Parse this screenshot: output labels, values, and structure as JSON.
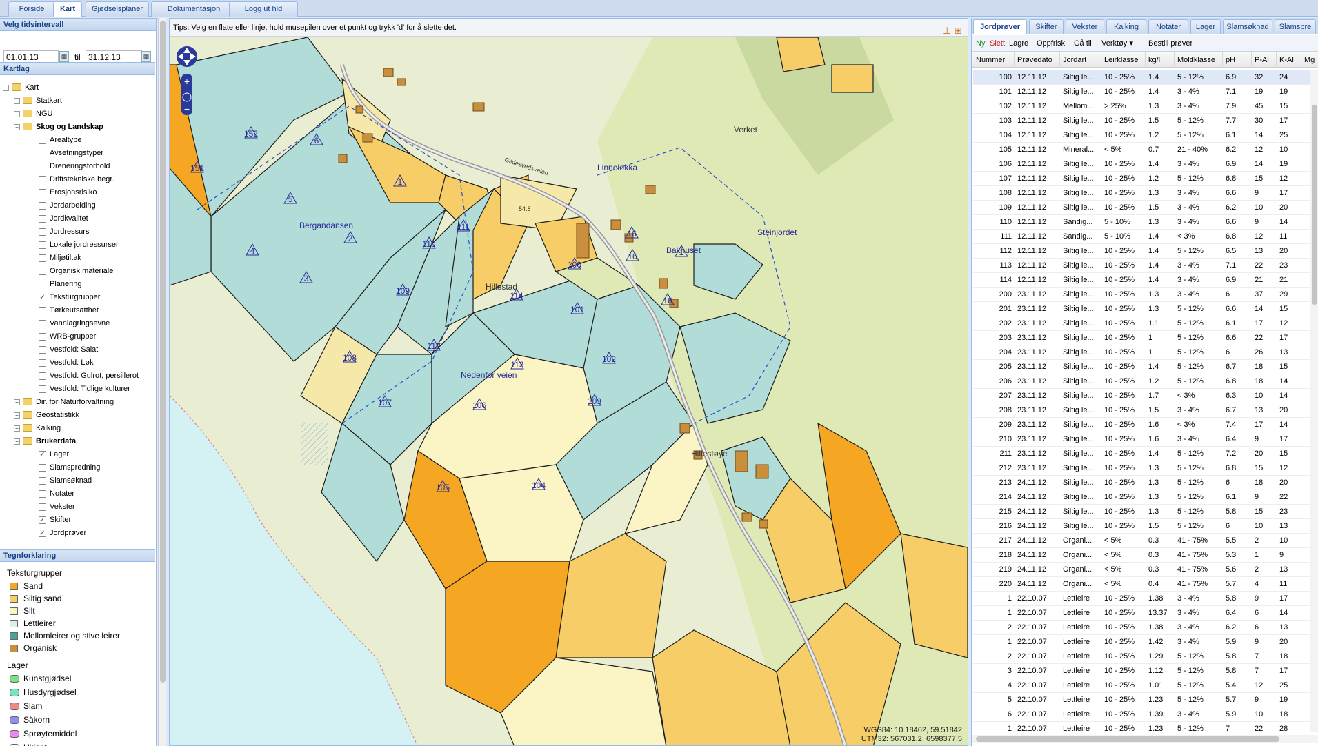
{
  "top_tabs": [
    {
      "label": "Forside",
      "active": false
    },
    {
      "label": "Kart",
      "active": true
    },
    {
      "label": "Gjødselsplaner",
      "active": false
    },
    {
      "label": "Dokumentasjon",
      "active": false
    },
    {
      "label": "Logg ut hld",
      "active": false
    }
  ],
  "time_interval": {
    "title": "Velg tidsintervall",
    "from": "01.01.13",
    "to_label": "til",
    "to": "31.12.13"
  },
  "layers": {
    "title": "Kartlag",
    "tree": [
      {
        "label": "Kart",
        "level": 0,
        "type": "folder",
        "expanded": true
      },
      {
        "label": "Statkart",
        "level": 1,
        "type": "folder",
        "expanded": false
      },
      {
        "label": "NGU",
        "level": 1,
        "type": "folder",
        "expanded": false
      },
      {
        "label": "Skog og Landskap",
        "level": 1,
        "type": "folder",
        "expanded": true,
        "bold": true
      },
      {
        "label": "Arealtype",
        "level": 2,
        "type": "check",
        "checked": false
      },
      {
        "label": "Avsetningstyper",
        "level": 2,
        "type": "check",
        "checked": false
      },
      {
        "label": "Dreneringsforhold",
        "level": 2,
        "type": "check",
        "checked": false
      },
      {
        "label": "Driftstekniske begr.",
        "level": 2,
        "type": "check",
        "checked": false
      },
      {
        "label": "Erosjonsrisiko",
        "level": 2,
        "type": "check",
        "checked": false
      },
      {
        "label": "Jordarbeiding",
        "level": 2,
        "type": "check",
        "checked": false
      },
      {
        "label": "Jordkvalitet",
        "level": 2,
        "type": "check",
        "checked": false
      },
      {
        "label": "Jordressurs",
        "level": 2,
        "type": "check",
        "checked": false
      },
      {
        "label": "Lokale jordressurser",
        "level": 2,
        "type": "check",
        "checked": false
      },
      {
        "label": "Miljøtiltak",
        "level": 2,
        "type": "check",
        "checked": false
      },
      {
        "label": "Organisk materiale",
        "level": 2,
        "type": "check",
        "checked": false
      },
      {
        "label": "Planering",
        "level": 2,
        "type": "check",
        "checked": false
      },
      {
        "label": "Teksturgrupper",
        "level": 2,
        "type": "check",
        "checked": true
      },
      {
        "label": "Tørkeutsatthet",
        "level": 2,
        "type": "check",
        "checked": false
      },
      {
        "label": "Vannlagringsevne",
        "level": 2,
        "type": "check",
        "checked": false
      },
      {
        "label": "WRB-grupper",
        "level": 2,
        "type": "check",
        "checked": false
      },
      {
        "label": "Vestfold: Salat",
        "level": 2,
        "type": "check",
        "checked": false
      },
      {
        "label": "Vestfold: Løk",
        "level": 2,
        "type": "check",
        "checked": false
      },
      {
        "label": "Vestfold: Gulrot, persillerot",
        "level": 2,
        "type": "check",
        "checked": false
      },
      {
        "label": "Vestfold: Tidlige kulturer",
        "level": 2,
        "type": "check",
        "checked": false
      },
      {
        "label": "Dir. for Naturforvaltning",
        "level": 1,
        "type": "folder",
        "expanded": false
      },
      {
        "label": "Geostatistikk",
        "level": 1,
        "type": "folder",
        "expanded": false
      },
      {
        "label": "Kalking",
        "level": 1,
        "type": "folder",
        "expanded": false
      },
      {
        "label": "Brukerdata",
        "level": 1,
        "type": "folder",
        "expanded": true,
        "bold": true
      },
      {
        "label": "Lager",
        "level": 2,
        "type": "check",
        "checked": true
      },
      {
        "label": "Slamspredning",
        "level": 2,
        "type": "check",
        "checked": false
      },
      {
        "label": "Slamsøknad",
        "level": 2,
        "type": "check",
        "checked": false
      },
      {
        "label": "Notater",
        "level": 2,
        "type": "check",
        "checked": false
      },
      {
        "label": "Vekster",
        "level": 2,
        "type": "check",
        "checked": false
      },
      {
        "label": "Skifter",
        "level": 2,
        "type": "check",
        "checked": true
      },
      {
        "label": "Jordprøver",
        "level": 2,
        "type": "check",
        "checked": true
      }
    ]
  },
  "legend": {
    "title": "Tegnforklaring",
    "groups": [
      {
        "title": "Teksturgrupper",
        "shape": "square",
        "items": [
          {
            "label": "Sand",
            "color": "#f5a623"
          },
          {
            "label": "Siltig sand",
            "color": "#f6cd67"
          },
          {
            "label": "Silt",
            "color": "#fbf5c6"
          },
          {
            "label": "Lettleirer",
            "color": "#d9efe8"
          },
          {
            "label": "Mellomleirer og stive leirer",
            "color": "#4aa3a0"
          },
          {
            "label": "Organisk",
            "color": "#c98f3c"
          }
        ]
      },
      {
        "title": "Lager",
        "shape": "round",
        "items": [
          {
            "label": "Kunstgjødsel",
            "color": "#7ee07e"
          },
          {
            "label": "Husdyrgjødsel",
            "color": "#7de2c3"
          },
          {
            "label": "Slam",
            "color": "#f08a86"
          },
          {
            "label": "Såkorn",
            "color": "#8f8ff2"
          },
          {
            "label": "Sprøytemiddel",
            "color": "#ef86ef"
          },
          {
            "label": "Ukjent",
            "color": "#ffffff"
          }
        ]
      }
    ]
  },
  "map": {
    "tips": "Tips: Velg en flate eller linje, hold musepilen over et punkt og trykk 'd' for å slette det.",
    "coords_wgs": "WGS84: 10.18462, 59.51842",
    "coords_utm": "UTM32: 567031.2, 6598377.5",
    "place_names": [
      "Verket",
      "Linneløkka",
      "Bergandansen",
      "Steinjordet",
      "Bakhuset",
      "Hillestad",
      "Nedenfor veien",
      "Hillestøye",
      "Gildesvedsveien",
      "54.8"
    ],
    "plots": [
      "152",
      "151",
      "6",
      "5",
      "1",
      "4",
      "2",
      "3",
      "111",
      "110",
      "109",
      "114",
      "101",
      "100",
      "108",
      "112",
      "113",
      "102",
      "107",
      "106",
      "103",
      "105",
      "104",
      "1",
      "16",
      "16",
      "16"
    ]
  },
  "grid": {
    "tabs": [
      "Jordprøver",
      "Skifter",
      "Vekster",
      "Kalking",
      "Notater",
      "Lager",
      "Slamsøknad",
      "Slamspre"
    ],
    "toolbar": {
      "new": "Ny",
      "delete": "Slett",
      "save": "Lagre",
      "refresh": "Oppfrisk",
      "goto": "Gå til",
      "tools": "Verktøy ▾",
      "order": "Bestill prøver"
    },
    "columns": [
      "Nummer",
      "Prøvedato",
      "Jordart",
      "Leirklasse",
      "kg/l",
      "Moldklasse",
      "pH",
      "P-Al",
      "K-Al",
      "Mg"
    ],
    "rows": [
      [
        "100",
        "12.11.12",
        "Siltig le...",
        "10 - 25%",
        "1.4",
        "5 - 12%",
        "6.9",
        "32",
        "24"
      ],
      [
        "101",
        "12.11.12",
        "Siltig le...",
        "10 - 25%",
        "1.4",
        "3 - 4%",
        "7.1",
        "19",
        "19"
      ],
      [
        "102",
        "12.11.12",
        "Mellom...",
        "> 25%",
        "1.3",
        "3 - 4%",
        "7.9",
        "45",
        "15"
      ],
      [
        "103",
        "12.11.12",
        "Siltig le...",
        "10 - 25%",
        "1.5",
        "5 - 12%",
        "7.7",
        "30",
        "17"
      ],
      [
        "104",
        "12.11.12",
        "Siltig le...",
        "10 - 25%",
        "1.2",
        "5 - 12%",
        "6.1",
        "14",
        "25"
      ],
      [
        "105",
        "12.11.12",
        "Mineral...",
        "< 5%",
        "0.7",
        "21 - 40%",
        "6.2",
        "12",
        "10"
      ],
      [
        "106",
        "12.11.12",
        "Siltig le...",
        "10 - 25%",
        "1.4",
        "3 - 4%",
        "6.9",
        "14",
        "19"
      ],
      [
        "107",
        "12.11.12",
        "Siltig le...",
        "10 - 25%",
        "1.2",
        "5 - 12%",
        "6.8",
        "15",
        "12"
      ],
      [
        "108",
        "12.11.12",
        "Siltig le...",
        "10 - 25%",
        "1.3",
        "3 - 4%",
        "6.6",
        "9",
        "17"
      ],
      [
        "109",
        "12.11.12",
        "Siltig le...",
        "10 - 25%",
        "1.5",
        "3 - 4%",
        "6.2",
        "10",
        "20"
      ],
      [
        "110",
        "12.11.12",
        "Sandig...",
        "5 - 10%",
        "1.3",
        "3 - 4%",
        "6.6",
        "9",
        "14"
      ],
      [
        "111",
        "12.11.12",
        "Sandig...",
        "5 - 10%",
        "1.4",
        "< 3%",
        "6.8",
        "12",
        "11"
      ],
      [
        "112",
        "12.11.12",
        "Siltig le...",
        "10 - 25%",
        "1.4",
        "5 - 12%",
        "6.5",
        "13",
        "20"
      ],
      [
        "113",
        "12.11.12",
        "Siltig le...",
        "10 - 25%",
        "1.4",
        "3 - 4%",
        "7.1",
        "22",
        "23"
      ],
      [
        "114",
        "12.11.12",
        "Siltig le...",
        "10 - 25%",
        "1.4",
        "3 - 4%",
        "6.9",
        "21",
        "21"
      ],
      [
        "200",
        "23.11.12",
        "Siltig le...",
        "10 - 25%",
        "1.3",
        "3 - 4%",
        "6",
        "37",
        "29"
      ],
      [
        "201",
        "23.11.12",
        "Siltig le...",
        "10 - 25%",
        "1.3",
        "5 - 12%",
        "6.6",
        "14",
        "15"
      ],
      [
        "202",
        "23.11.12",
        "Siltig le...",
        "10 - 25%",
        "1.1",
        "5 - 12%",
        "6.1",
        "17",
        "12"
      ],
      [
        "203",
        "23.11.12",
        "Siltig le...",
        "10 - 25%",
        "1",
        "5 - 12%",
        "6.6",
        "22",
        "17"
      ],
      [
        "204",
        "23.11.12",
        "Siltig le...",
        "10 - 25%",
        "1",
        "5 - 12%",
        "6",
        "26",
        "13"
      ],
      [
        "205",
        "23.11.12",
        "Siltig le...",
        "10 - 25%",
        "1.4",
        "5 - 12%",
        "6.7",
        "18",
        "15"
      ],
      [
        "206",
        "23.11.12",
        "Siltig le...",
        "10 - 25%",
        "1.2",
        "5 - 12%",
        "6.8",
        "18",
        "14"
      ],
      [
        "207",
        "23.11.12",
        "Siltig le...",
        "10 - 25%",
        "1.7",
        "< 3%",
        "6.3",
        "10",
        "14"
      ],
      [
        "208",
        "23.11.12",
        "Siltig le...",
        "10 - 25%",
        "1.5",
        "3 - 4%",
        "6.7",
        "13",
        "20"
      ],
      [
        "209",
        "23.11.12",
        "Siltig le...",
        "10 - 25%",
        "1.6",
        "< 3%",
        "7.4",
        "17",
        "14"
      ],
      [
        "210",
        "23.11.12",
        "Siltig le...",
        "10 - 25%",
        "1.6",
        "3 - 4%",
        "6.4",
        "9",
        "17"
      ],
      [
        "211",
        "23.11.12",
        "Siltig le...",
        "10 - 25%",
        "1.4",
        "5 - 12%",
        "7.2",
        "20",
        "15"
      ],
      [
        "212",
        "23.11.12",
        "Siltig le...",
        "10 - 25%",
        "1.3",
        "5 - 12%",
        "6.8",
        "15",
        "12"
      ],
      [
        "213",
        "24.11.12",
        "Siltig le...",
        "10 - 25%",
        "1.3",
        "5 - 12%",
        "6",
        "18",
        "20"
      ],
      [
        "214",
        "24.11.12",
        "Siltig le...",
        "10 - 25%",
        "1.3",
        "5 - 12%",
        "6.1",
        "9",
        "22"
      ],
      [
        "215",
        "24.11.12",
        "Siltig le...",
        "10 - 25%",
        "1.3",
        "5 - 12%",
        "5.8",
        "15",
        "23"
      ],
      [
        "216",
        "24.11.12",
        "Siltig le...",
        "10 - 25%",
        "1.5",
        "5 - 12%",
        "6",
        "10",
        "13"
      ],
      [
        "217",
        "24.11.12",
        "Organi...",
        "< 5%",
        "0.3",
        "41 - 75%",
        "5.5",
        "2",
        "10"
      ],
      [
        "218",
        "24.11.12",
        "Organi...",
        "< 5%",
        "0.3",
        "41 - 75%",
        "5.3",
        "1",
        "9"
      ],
      [
        "219",
        "24.11.12",
        "Organi...",
        "< 5%",
        "0.3",
        "41 - 75%",
        "5.6",
        "2",
        "13"
      ],
      [
        "220",
        "24.11.12",
        "Organi...",
        "< 5%",
        "0.4",
        "41 - 75%",
        "5.7",
        "4",
        "11"
      ],
      [
        "1",
        "22.10.07",
        "Lettleire",
        "10 - 25%",
        "1.38",
        "3 - 4%",
        "5.8",
        "9",
        "17"
      ],
      [
        "1",
        "22.10.07",
        "Lettleire",
        "10 - 25%",
        "13.37",
        "3 - 4%",
        "6.4",
        "6",
        "14"
      ],
      [
        "2",
        "22.10.07",
        "Lettleire",
        "10 - 25%",
        "1.38",
        "3 - 4%",
        "6.2",
        "6",
        "13"
      ],
      [
        "1",
        "22.10.07",
        "Lettleire",
        "10 - 25%",
        "1.42",
        "3 - 4%",
        "5.9",
        "9",
        "20"
      ],
      [
        "2",
        "22.10.07",
        "Lettleire",
        "10 - 25%",
        "1.29",
        "5 - 12%",
        "5.8",
        "7",
        "18"
      ],
      [
        "3",
        "22.10.07",
        "Lettleire",
        "10 - 25%",
        "1.12",
        "5 - 12%",
        "5.8",
        "7",
        "17"
      ],
      [
        "4",
        "22.10.07",
        "Lettleire",
        "10 - 25%",
        "1.01",
        "5 - 12%",
        "5.4",
        "12",
        "25"
      ],
      [
        "5",
        "22.10.07",
        "Lettleire",
        "10 - 25%",
        "1.23",
        "5 - 12%",
        "5.7",
        "9",
        "19"
      ],
      [
        "6",
        "22.10.07",
        "Lettleire",
        "10 - 25%",
        "1.39",
        "3 - 4%",
        "5.9",
        "10",
        "18"
      ],
      [
        "1",
        "22.10.07",
        "Lettleire",
        "10 - 25%",
        "1.23",
        "5 - 12%",
        "7",
        "22",
        "28"
      ]
    ]
  }
}
